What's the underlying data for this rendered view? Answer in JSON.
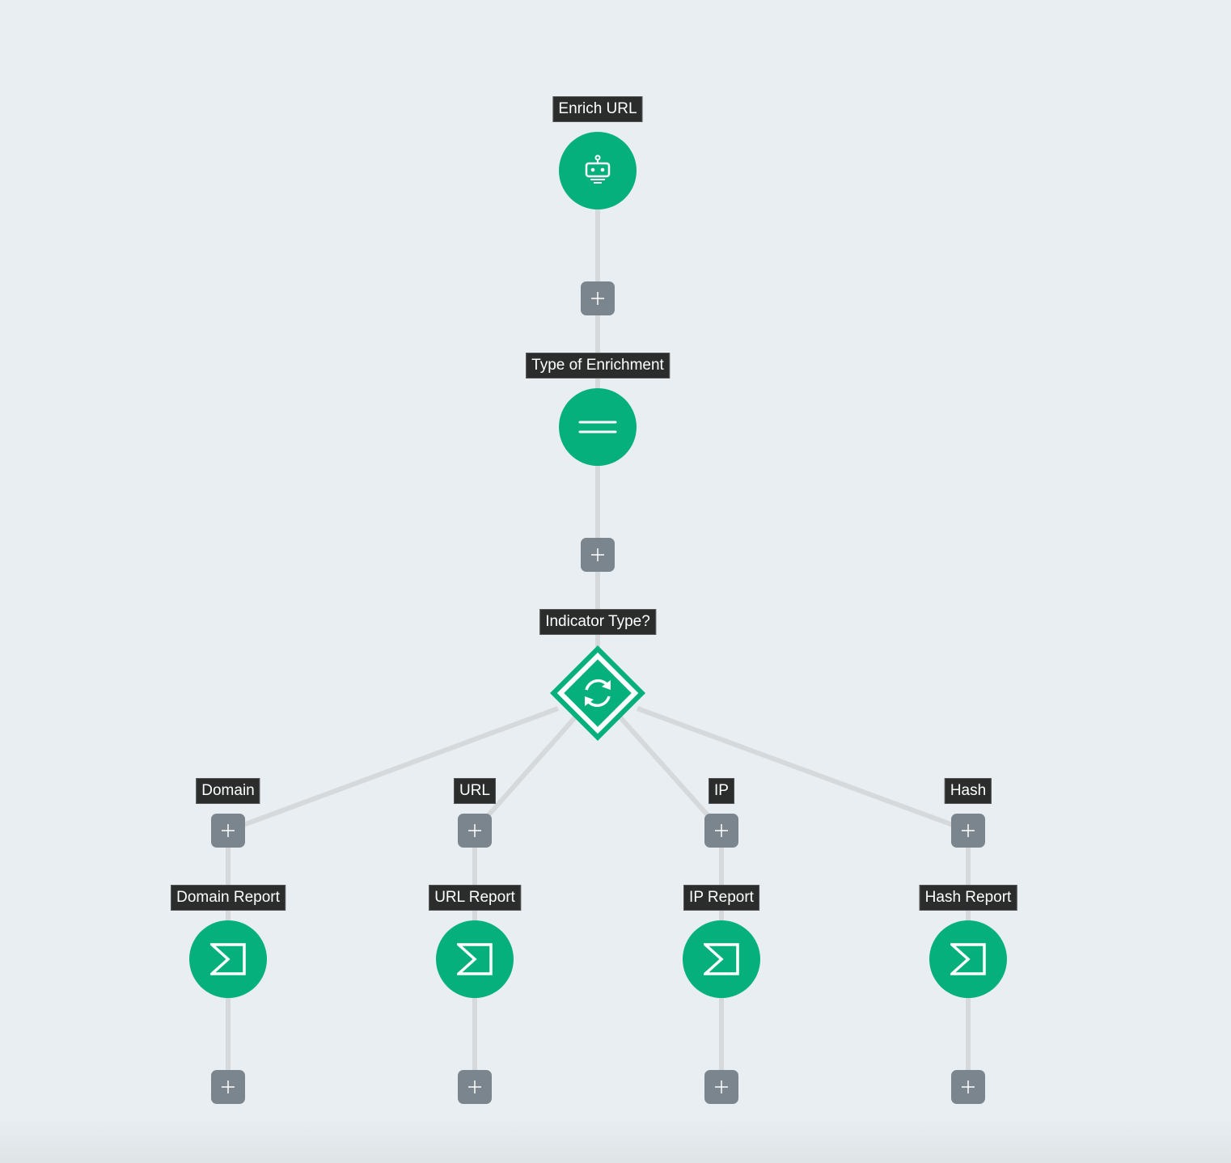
{
  "diagram": {
    "type": "playbook-flow",
    "accent_color": "#05b07d",
    "nodes": [
      {
        "id": "enrich_url",
        "label": "Enrich URL",
        "kind": "action",
        "icon": "robot-icon"
      },
      {
        "id": "type_of_enrichment",
        "label": "Type of Enrichment",
        "kind": "filter",
        "icon": "equals-icon"
      },
      {
        "id": "indicator_type",
        "label": "Indicator Type?",
        "kind": "decision",
        "icon": "refresh-icon"
      },
      {
        "id": "domain_report",
        "label": "Domain Report",
        "kind": "format",
        "icon": "sigma-icon"
      },
      {
        "id": "url_report",
        "label": "URL Report",
        "kind": "format",
        "icon": "sigma-icon"
      },
      {
        "id": "ip_report",
        "label": "IP Report",
        "kind": "format",
        "icon": "sigma-icon"
      },
      {
        "id": "hash_report",
        "label": "Hash Report",
        "kind": "format",
        "icon": "sigma-icon"
      }
    ],
    "branches": [
      {
        "label": "Domain",
        "target": "domain_report"
      },
      {
        "label": "URL",
        "target": "url_report"
      },
      {
        "label": "IP",
        "target": "ip_report"
      },
      {
        "label": "Hash",
        "target": "hash_report"
      }
    ],
    "edges": [
      [
        "enrich_url",
        "type_of_enrichment"
      ],
      [
        "type_of_enrichment",
        "indicator_type"
      ],
      [
        "indicator_type",
        "domain_report"
      ],
      [
        "indicator_type",
        "url_report"
      ],
      [
        "indicator_type",
        "ip_report"
      ],
      [
        "indicator_type",
        "hash_report"
      ]
    ],
    "add_step_symbol": "+"
  }
}
